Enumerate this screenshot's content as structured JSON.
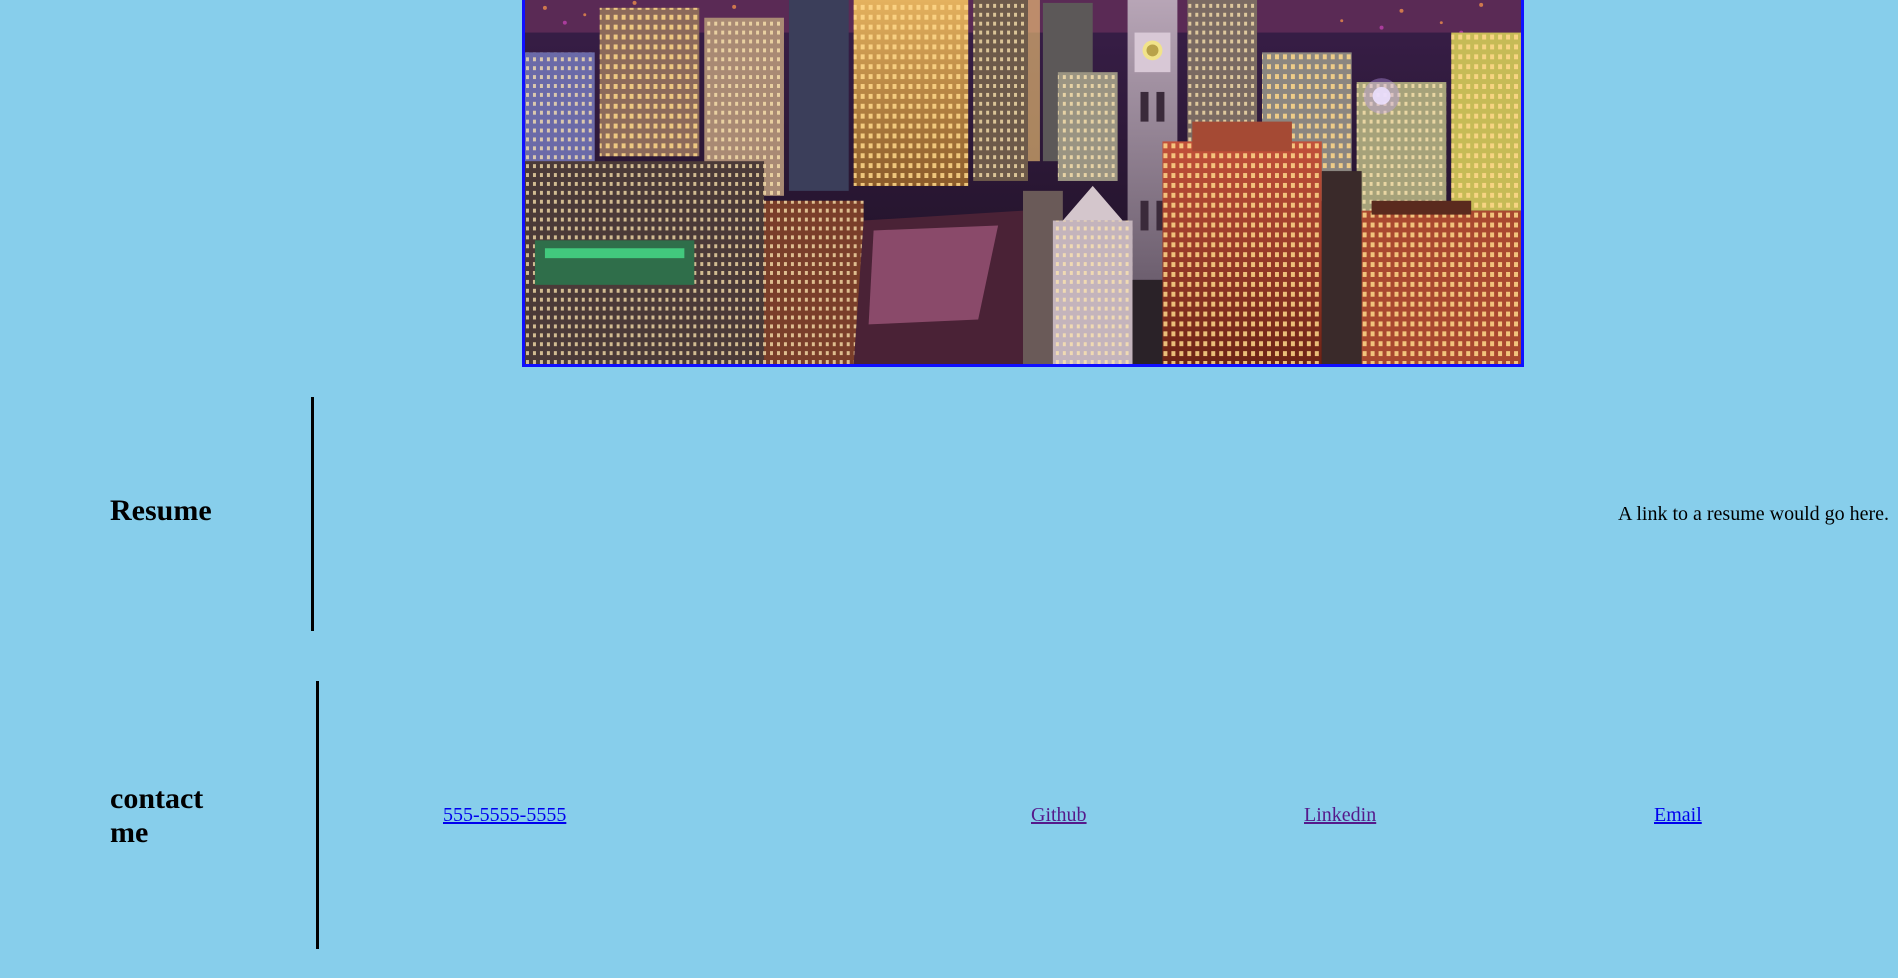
{
  "hero": {
    "image_name": "city-night-skyline-image",
    "border_color": "#1010ff"
  },
  "resume": {
    "heading": "Resume",
    "text": "A link to a resume would go here."
  },
  "contact": {
    "heading": "contact me",
    "links": {
      "phone": "555-5555-5555",
      "github": "Github",
      "linkedin": "Linkedin",
      "email": "Email"
    }
  },
  "colors": {
    "background": "#87ceeb",
    "link": "#0000ee",
    "visited_link": "#551a8b",
    "divider": "#000000"
  }
}
